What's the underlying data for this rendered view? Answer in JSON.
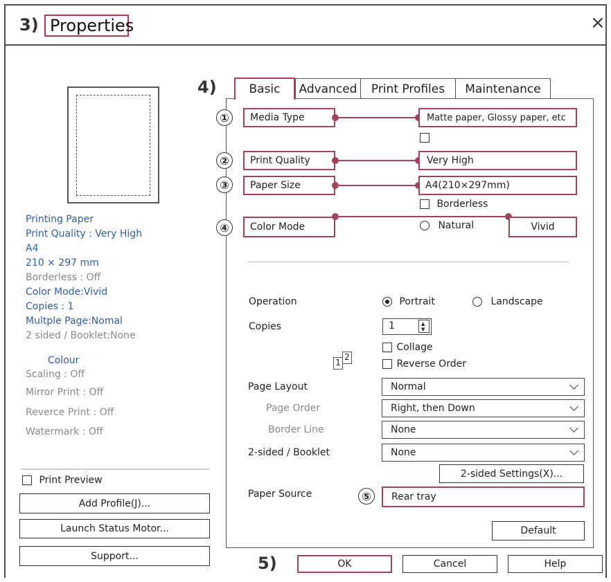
{
  "window": {
    "step_title": "3)",
    "title": "Properties",
    "close_glyph": "×"
  },
  "left": {
    "info_lines": [
      {
        "text": "Printing Paper",
        "tone": "blue"
      },
      {
        "text": "Print Quality : Very High",
        "tone": "blue"
      },
      {
        "text": "A4",
        "tone": "blue"
      },
      {
        "text": "210 × 297 mm",
        "tone": "blue"
      },
      {
        "text": "Borderless : Off",
        "tone": "gray"
      },
      {
        "text": "Color Mode:Vivid",
        "tone": "blue"
      },
      {
        "text": "Copies : 1",
        "tone": "blue"
      },
      {
        "text": "Multple Page:Nomal",
        "tone": "blue"
      },
      {
        "text": "2 sided / Booklet:None",
        "tone": "gray"
      }
    ],
    "colour_heading": "Colour",
    "extra_lines": [
      "Scaling : Off",
      "Mirror Print : Off",
      "Reverce Print : Off",
      "Watermark : Off"
    ],
    "print_preview_label": "Print Preview",
    "add_profile_label": "Add Profile(J)...",
    "launch_status_label": "Launch Status Motor...",
    "support_label": "Support..."
  },
  "tabs": {
    "step": "4)",
    "items": [
      "Basic",
      "Advanced",
      "Print Profiles",
      "Maintenance"
    ],
    "active": "Basic"
  },
  "media": {
    "rows": [
      {
        "num": "①",
        "label": "Media Type",
        "value": "Matte paper, Glossy paper, etc"
      },
      {
        "num": "②",
        "label": "Print Quality",
        "value": "Very High"
      },
      {
        "num": "③",
        "label": "Paper Size",
        "value": "A4(210×297mm)"
      },
      {
        "num": "④",
        "label": "Color Mode",
        "value": ""
      }
    ],
    "borderless_label": "Borderless",
    "color_natural_label": "Natural",
    "color_vivid_label": "Vivid"
  },
  "operation": {
    "label": "Operation",
    "portrait_label": "Portrait",
    "landscape_label": "Landscape",
    "selected": "Portrait"
  },
  "copies": {
    "label": "Copies",
    "value": "1",
    "collage_label": "Collage",
    "reverse_label": "Reverse Order",
    "icon_a": "1",
    "icon_b": "2"
  },
  "layout": {
    "page_layout_label": "Page Layout",
    "page_layout_value": "Normal",
    "page_order_label": "Page Order",
    "page_order_value": "Right, then Down",
    "border_line_label": "Border Line",
    "border_line_value": "None",
    "two_sided_label": "2-sided / Booklet",
    "two_sided_value": "None",
    "two_sided_settings_label": "2-sided Settings(X)..."
  },
  "paper_source": {
    "num": "⑤",
    "label": "Paper Source",
    "value": "Rear tray"
  },
  "default_label": "Default",
  "footer": {
    "step": "5)",
    "ok_label": "OK",
    "cancel_label": "Cancel",
    "help_label": "Help"
  },
  "colors": {
    "highlight": "#a0445c",
    "info_blue": "#2f5fa8",
    "info_gray": "#8a8a8a"
  }
}
